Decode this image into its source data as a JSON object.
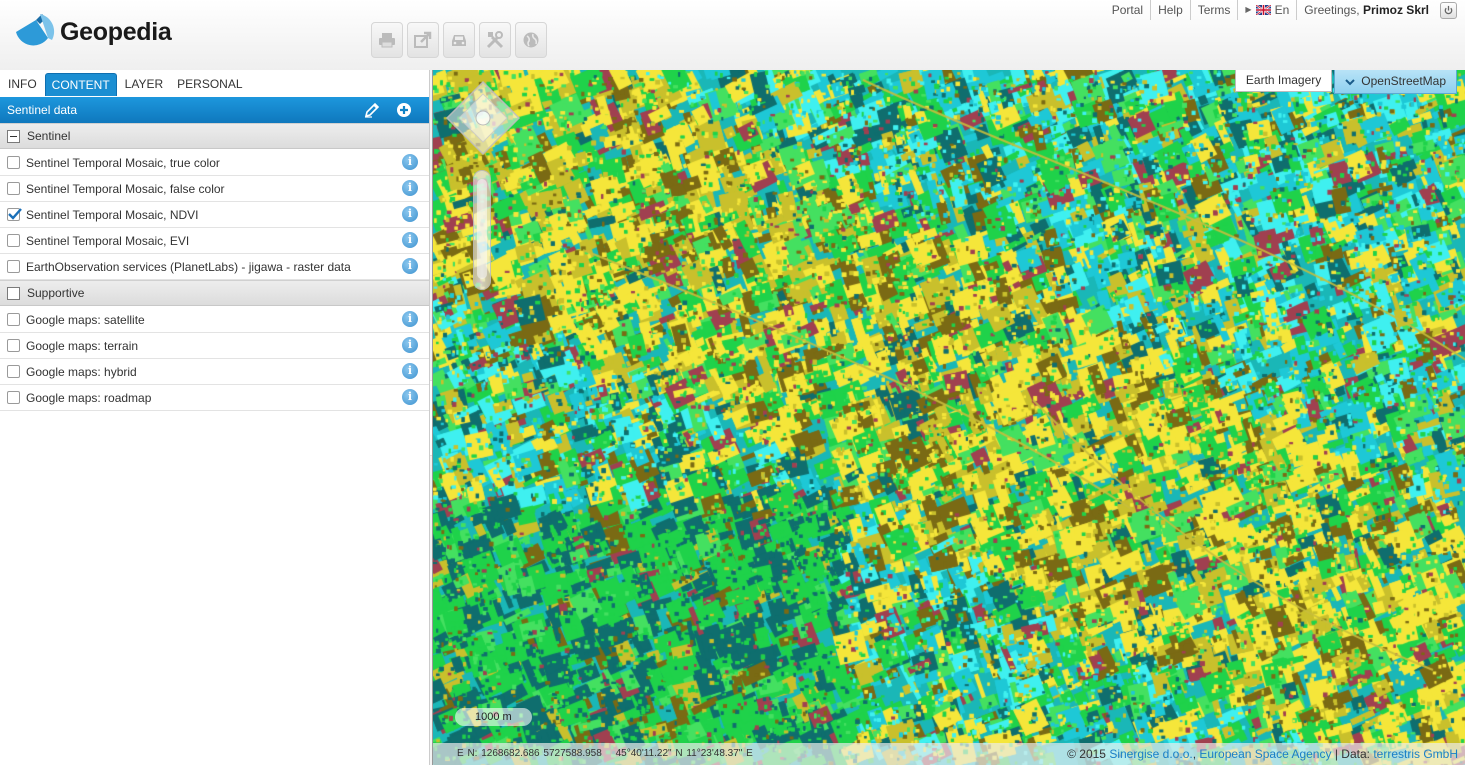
{
  "app": {
    "logo_text": "Geopedia"
  },
  "toplinks": {
    "portal": "Portal",
    "help": "Help",
    "terms": "Terms",
    "language": "En",
    "greeting_prefix": "Greetings,",
    "user_name": "Primoz Skrl"
  },
  "toolbar": {
    "buttons": [
      "print-icon",
      "share-icon",
      "route-icon",
      "tools-icon",
      "globe-icon"
    ]
  },
  "sidebar": {
    "tabs": [
      {
        "label": "INFO",
        "active": false
      },
      {
        "label": "CONTENT",
        "active": true
      },
      {
        "label": "LAYER",
        "active": false
      },
      {
        "label": "PERSONAL",
        "active": false
      }
    ],
    "panel_title": "Sentinel data",
    "groups": [
      {
        "name": "Sentinel",
        "expanded": true,
        "layers": [
          {
            "label": "Sentinel Temporal Mosaic, true color",
            "checked": false
          },
          {
            "label": "Sentinel Temporal Mosaic, false color",
            "checked": false
          },
          {
            "label": "Sentinel Temporal Mosaic, NDVI",
            "checked": true
          },
          {
            "label": "Sentinel Temporal Mosaic, EVI",
            "checked": false
          },
          {
            "label": "EarthObservation services (PlanetLabs) - jigawa - raster data",
            "checked": false
          }
        ]
      },
      {
        "name": "Supportive",
        "expanded": true,
        "layers": [
          {
            "label": "Google maps: satellite",
            "checked": false
          },
          {
            "label": "Google maps: terrain",
            "checked": false
          },
          {
            "label": "Google maps: hybrid",
            "checked": false
          },
          {
            "label": "Google maps: roadmap",
            "checked": false
          }
        ]
      }
    ]
  },
  "map": {
    "basemaps": [
      {
        "label": "Earth Imagery",
        "active": false
      },
      {
        "label": "OpenStreetMap",
        "active": true
      }
    ],
    "scale_label": "1000 m",
    "coords_en": "E N: 1268682.686 5727588.958",
    "coords_latlon": "45°40'11.22\" N 11°23'48.37\" E",
    "credits": {
      "copyright": "© 2015",
      "org1": "Sinergise d.o.o.",
      "org2": "European Space Agency",
      "data_prefix": "| Data:",
      "data_org": "terrestris GmbH"
    },
    "palette": [
      "#f5e63a",
      "#c9c02c",
      "#7a6a14",
      "#1ec8d6",
      "#3ff0f0",
      "#0f6e6e",
      "#1fd24a",
      "#44e060",
      "#a04050"
    ]
  }
}
